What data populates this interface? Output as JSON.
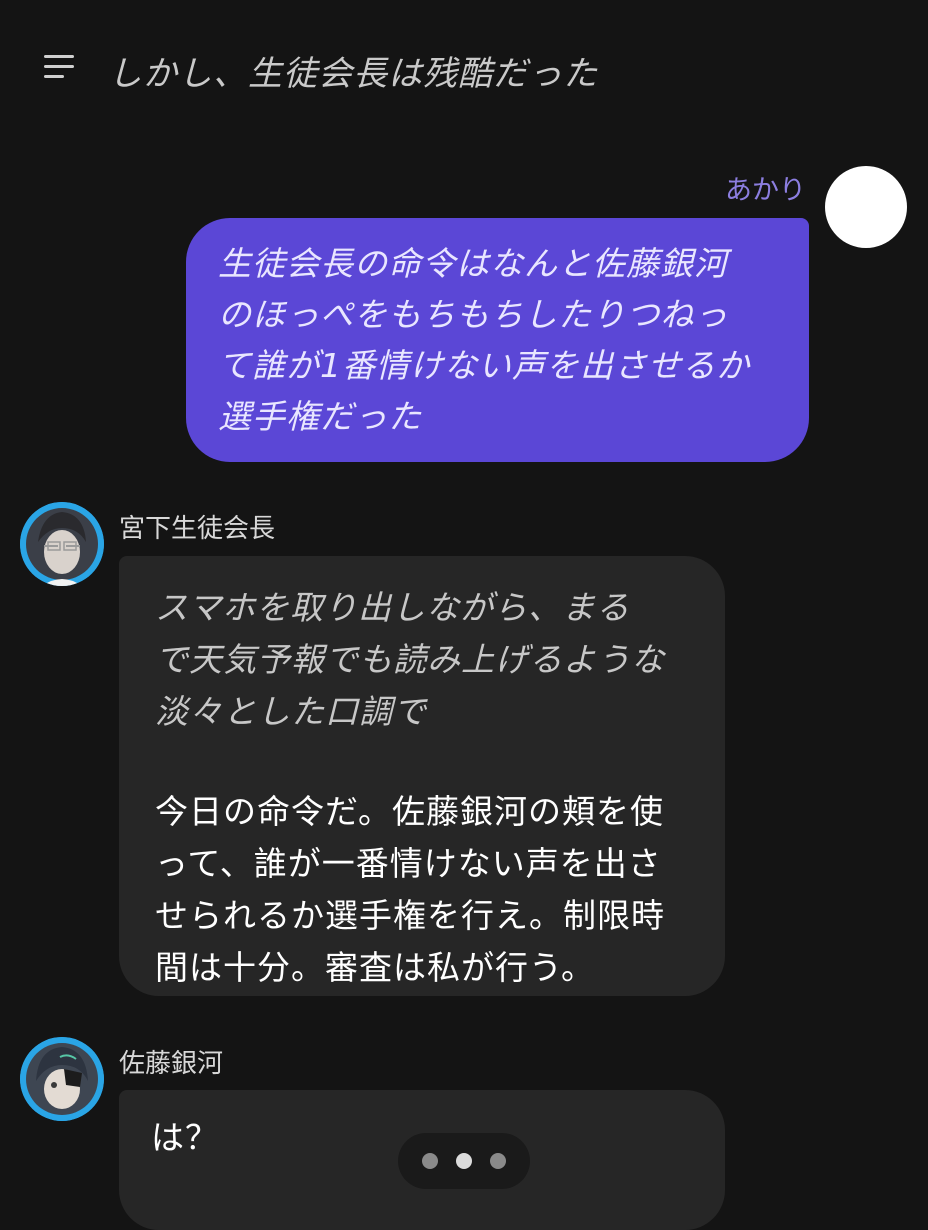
{
  "header": {
    "title": "しかし、生徒会長は残酷だった",
    "menu_icon": "menu-icon"
  },
  "messages": [
    {
      "sender": "あかり",
      "role": "user",
      "lines": [
        "生徒会長の命令はなんと佐藤銀河",
        "のほっぺをもちもちしたりつねっ",
        "て誰が1番情けない声を出させるか",
        "選手権だった"
      ]
    },
    {
      "sender": "宮下生徒会長",
      "role": "character",
      "action_lines": [
        "スマホを取り出しながら、まる",
        "で天気予報でも読み上げるような",
        "淡々とした口調で"
      ],
      "speech_lines": [
        "今日の命令だ。佐藤銀河の頬を使",
        "って、誰が一番情けない声を出さ",
        "せられるか選手権を行え。制限時",
        "間は十分。審査は私が行う。"
      ]
    },
    {
      "sender": "佐藤銀河",
      "role": "character",
      "text": "は？"
    }
  ],
  "colors": {
    "background": "#141414",
    "user_bubble": "#5b47d6",
    "user_name": "#8c7ee0",
    "char_bubble": "#262626",
    "avatar_ring": "#2aa5e6"
  },
  "typing_indicator": {
    "icon": "typing-dots-icon"
  }
}
